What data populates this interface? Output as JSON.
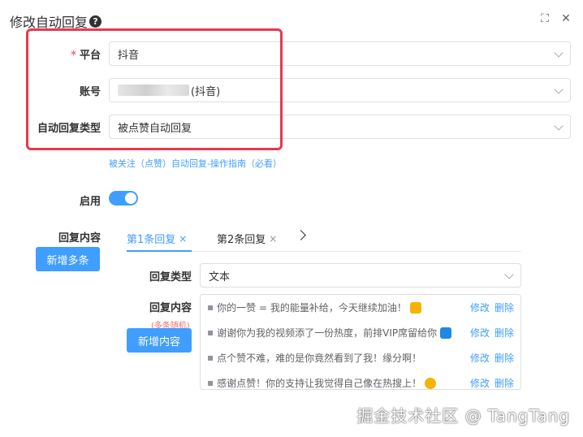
{
  "dialog": {
    "title": "修改自动回复",
    "help_glyph": "?",
    "fullscreen_glyph": "⛶",
    "close_glyph": "✕"
  },
  "form": {
    "platform": {
      "required_mark": "*",
      "label": "平台",
      "value": "抖音"
    },
    "account": {
      "label": "账号",
      "value_suffix": "(抖音)"
    },
    "reply_type": {
      "label": "自动回复类型",
      "value": "被点赞自动回复"
    },
    "guide_link": "被关注（点赞）自动回复-操作指南（必看）",
    "enabled": {
      "label": "启用",
      "on": true
    },
    "content": {
      "label": "回复内容",
      "add_multiple_button": "新增多条",
      "tabs": [
        {
          "label": "第1条回复",
          "close": "×",
          "active": true
        },
        {
          "label": "第2条回复",
          "close": "×",
          "active": false
        }
      ],
      "type_label": "回复类型",
      "type_value": "文本",
      "inner_label": "回复内容",
      "inner_note": "(多条随机)",
      "add_content_button": "新增内容",
      "edit_label": "修改",
      "delete_label": "删除",
      "bullet": "▪",
      "items": [
        {
          "text": "你的一赞 = 我的能量补给，今天继续加油！",
          "emoji_color": "#f4b400"
        },
        {
          "text": "谢谢你为我的视频添了一份热度，前排VIP席留给你",
          "emoji_color": "#1e88e5"
        },
        {
          "text": "点个赞不难，难的是你竟然看到了我！缘分啊！",
          "emoji_color": ""
        },
        {
          "text": "感谢点赞！你的支持让我觉得自己像在热搜上！",
          "emoji_color": "#f4b400"
        }
      ]
    }
  },
  "watermark": "掘金技术社区 @ TangTang",
  "colors": {
    "primary": "#409eff",
    "danger": "#f56c6c",
    "highlight_box": "#e8394d"
  }
}
